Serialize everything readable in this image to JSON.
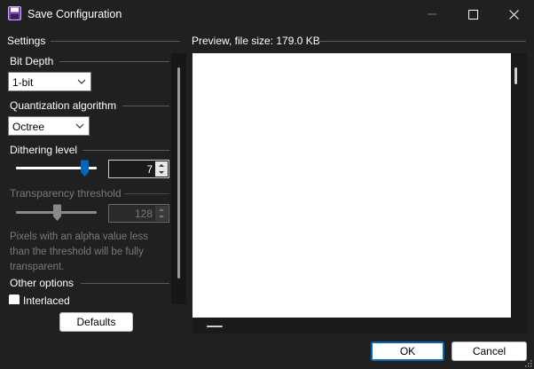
{
  "window": {
    "title": "Save Configuration",
    "icon": "floppy-disk-icon",
    "controls": [
      "minimize-icon",
      "maximize-icon",
      "close-icon"
    ]
  },
  "settings": {
    "header": "Settings",
    "bit_depth": {
      "label": "Bit Depth",
      "value": "1-bit"
    },
    "quantization": {
      "label": "Quantization algorithm",
      "value": "Octree"
    },
    "dithering": {
      "label": "Dithering level",
      "value": "7",
      "level_fraction": 0.9
    },
    "transparency": {
      "label": "Transparency threshold",
      "value": "128",
      "level_fraction": 0.5,
      "enabled": false,
      "help": "Pixels with an alpha value less than the threshold will be fully transparent."
    },
    "other_options": {
      "label": "Other options",
      "interlaced_label": "Interlaced",
      "interlaced_checked": false
    }
  },
  "defaults_button": "Defaults",
  "preview": {
    "header": "Preview, file size: 179.0 KB"
  },
  "footer": {
    "ok": "OK",
    "cancel": "Cancel"
  },
  "colors": {
    "accent": "#0067c0",
    "background": "#202020",
    "preview_bg": "#ffffff"
  }
}
